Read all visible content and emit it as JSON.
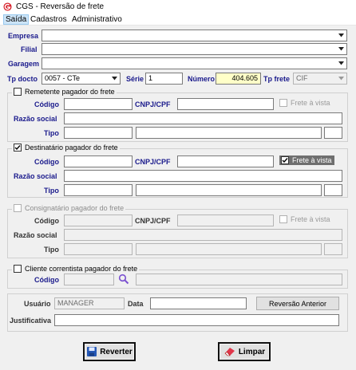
{
  "window": {
    "title": "CGS - Reversão de frete"
  },
  "menu": [
    "Saída",
    "Cadastros",
    "Administrativo"
  ],
  "top": {
    "empresa_label": "Empresa",
    "filial_label": "Filial",
    "garagem_label": "Garagem",
    "tp_docto_label": "Tp docto",
    "tp_docto_value": "0057 - CTe",
    "serie_label": "Série",
    "serie_value": "1",
    "numero_label": "Número",
    "numero_value": "404.605",
    "tp_frete_label": "Tp frete",
    "tp_frete_value": "CIF"
  },
  "remetente": {
    "title": "Remetente pagador do frete",
    "checked": false,
    "codigo_label": "Código",
    "cnpj_label": "CNPJ/CPF",
    "frete_vista_label": "Frete à vista",
    "razao_label": "Razão social",
    "tipo_label": "Tipo"
  },
  "destinatario": {
    "title": "Destinatário pagador do frete",
    "checked": true,
    "codigo_label": "Código",
    "cnpj_label": "CNPJ/CPF",
    "frete_vista_label": "Frete à vista",
    "frete_vista_checked": true,
    "razao_label": "Razão social",
    "tipo_label": "Tipo"
  },
  "consignatario": {
    "title": "Consignatário pagador do frete",
    "checked": false,
    "codigo_label": "Código",
    "cnpj_label": "CNPJ/CPF",
    "frete_vista_label": "Frete à vista",
    "razao_label": "Razão social",
    "tipo_label": "Tipo"
  },
  "correntista": {
    "title": "Cliente correntista pagador do frete",
    "checked": false,
    "codigo_label": "Código"
  },
  "bottom": {
    "usuario_label": "Usuário",
    "usuario_value": "MANAGER",
    "data_label": "Data",
    "reversao_button": "Reversão Anterior",
    "justificativa_label": "Justificativa"
  },
  "actions": {
    "reverter": "Reverter",
    "limpar": "Limpar"
  },
  "colors": {
    "label_blue": "#1a1a8c",
    "numero_bg": "#ffffc8",
    "selected_checkbox_bg": "#6f6f6f",
    "app_icon_red": "#d7202a"
  },
  "icons": [
    "app-logo-icon",
    "chevron-down-icon",
    "checkmark-icon",
    "search-icon",
    "floppy-disk-icon",
    "eraser-icon"
  ]
}
